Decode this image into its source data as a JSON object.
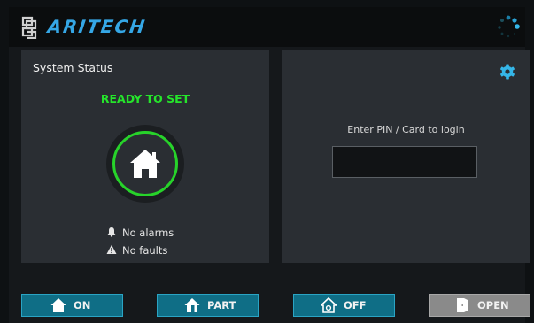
{
  "header": {
    "brand": "ARITECH",
    "logo_icon": "aritech-logo-icon",
    "accent_color": "#35a7e6"
  },
  "status_panel": {
    "title": "System Status",
    "state": "READY TO SET",
    "state_color": "#25e52b",
    "icon": "home-icon",
    "messages": [
      {
        "icon": "bell-icon",
        "text": "No alarms"
      },
      {
        "icon": "warning-icon",
        "text": "No faults"
      }
    ]
  },
  "login_panel": {
    "settings_icon": "gear-icon",
    "prompt": "Enter PIN / Card to login",
    "pin_value": ""
  },
  "buttons": [
    {
      "label": "ON",
      "icon": "home-icon"
    },
    {
      "label": "PART",
      "icon": "home-part-icon"
    },
    {
      "label": "OFF",
      "icon": "home-off-icon"
    },
    {
      "label": "OPEN",
      "icon": "door-icon"
    }
  ]
}
